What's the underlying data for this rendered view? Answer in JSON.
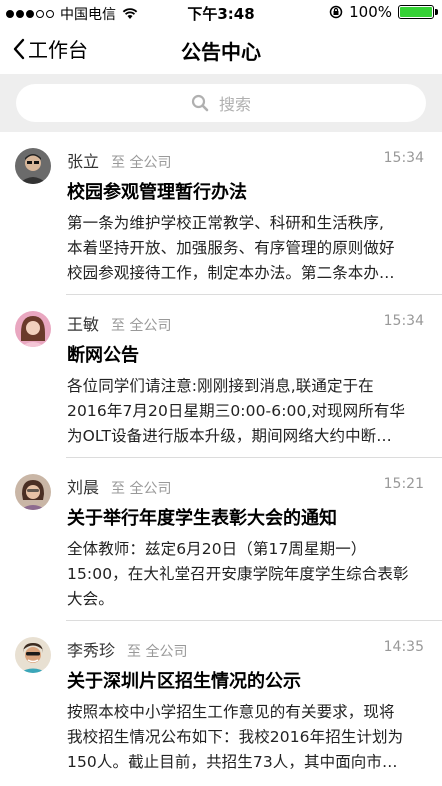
{
  "status_bar": {
    "carrier": "中国电信",
    "time": "下午3:48",
    "battery": "100%",
    "battery_level": 1.0
  },
  "nav": {
    "back_label": "工作台",
    "title": "公告中心"
  },
  "search": {
    "placeholder": "搜索"
  },
  "notices": [
    {
      "sender": "张立",
      "scope": "至 全公司",
      "time": "15:34",
      "title": "校园参观管理暂行办法",
      "body": "第一条为维护学校正常教学、科研和生活秩序,\n本着坚持开放、加强服务、有序管理的原则做好\n校园参观接待工作，制定本办法。第二条本办…"
    },
    {
      "sender": "王敏",
      "scope": "至 全公司",
      "time": "15:34",
      "title": "断网公告",
      "body": "各位同学们请注意:刚刚接到消息,联通定于在\n2016年7月20日星期三0:00-6:00,对现网所有华\n为OLT设备进行版本升级，期间网络大约中断…"
    },
    {
      "sender": "刘晨",
      "scope": "至 全公司",
      "time": "15:21",
      "title": "关于举行年度学生表彰大会的通知",
      "body": "全体教师：兹定6月20日（第17周星期一）\n15:00，在大礼堂召开安康学院年度学生综合表彰\n大会。"
    },
    {
      "sender": "李秀珍",
      "scope": "至 全公司",
      "time": "14:35",
      "title": "关于深圳片区招生情况的公示",
      "body": "按照本校中小学招生工作意见的有关要求，现将\n我校招生情况公布如下：我校2016年招生计划为\n150人。截止目前，共招生73人，其中面向市…"
    }
  ]
}
